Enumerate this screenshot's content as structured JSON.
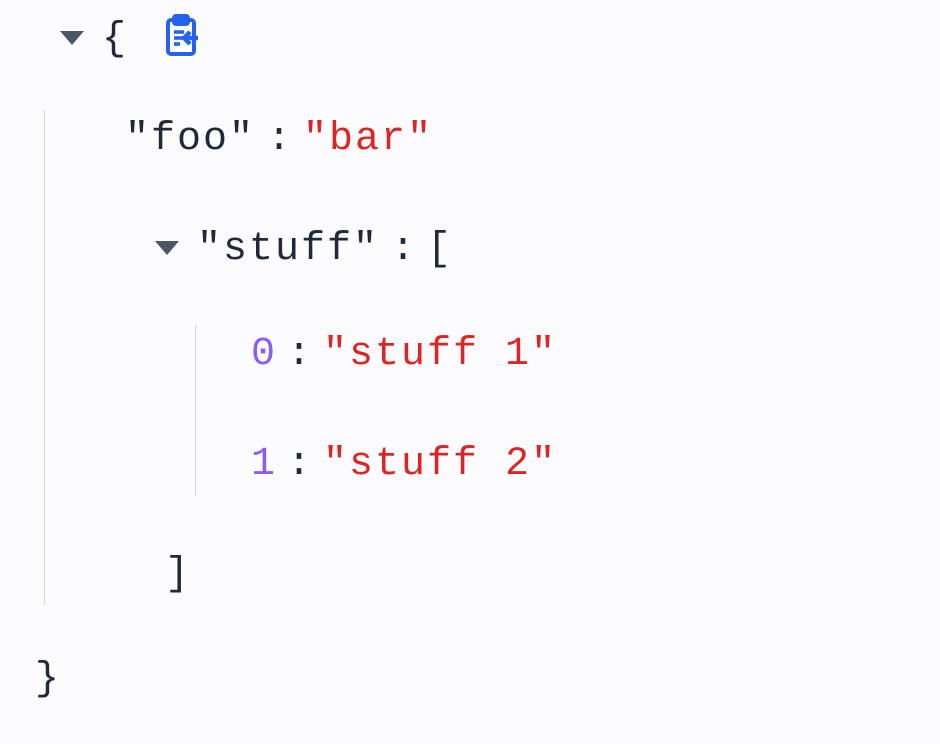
{
  "root": {
    "open_brace": "{",
    "close_brace": "}"
  },
  "properties": {
    "foo": {
      "key": "\"foo\"",
      "value": "\"bar\""
    },
    "stuff": {
      "key": "\"stuff\"",
      "open_bracket": "[",
      "close_bracket": "]",
      "items": [
        {
          "index": "0",
          "value": "\"stuff 1\""
        },
        {
          "index": "1",
          "value": "\"stuff 2\""
        }
      ]
    }
  },
  "separators": {
    "colon": ":"
  }
}
